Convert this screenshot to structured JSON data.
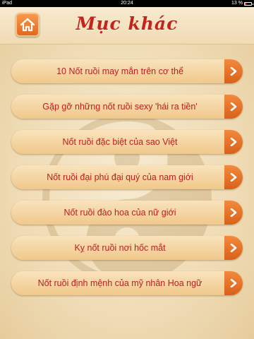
{
  "status_bar": {
    "carrier": "iPad",
    "time": "20:24",
    "battery": "13 %"
  },
  "header": {
    "title": "Mục khác",
    "home_icon": "home-icon"
  },
  "menu": {
    "items": [
      {
        "label": "10 Nốt ruồi may mắn trên cơ thể"
      },
      {
        "label": "Gặp gỡ những nốt ruồi sexy 'hái ra tiền'"
      },
      {
        "label": "Nốt ruồi đặc biệt của sao Việt"
      },
      {
        "label": "Nốt ruồi đại phú đại quý của nam giới"
      },
      {
        "label": "Nốt ruồi đào hoa của nữ giới"
      },
      {
        "label": "Kỵ nốt ruồi nơi hốc mắt"
      },
      {
        "label": "Nốt ruồi định mệnh của mỹ nhân Hoa ngữ"
      }
    ]
  },
  "colors": {
    "accent": "#e0691f",
    "title": "#c3241c",
    "label": "#b62121",
    "background": "#f3e4c2"
  }
}
